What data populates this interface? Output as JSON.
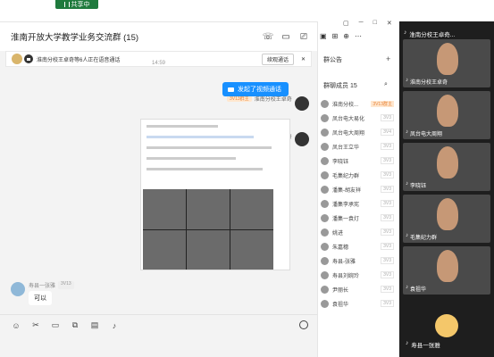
{
  "share_bar": {
    "label": "共享中"
  },
  "chat": {
    "title": "淮南开放大学教学业务交流群 (15)",
    "banner": {
      "text": "淮南分校王卓奇等6人正在语音通话",
      "button": "续观通话"
    },
    "time": "14:59",
    "sender": {
      "tag": "3V13群主",
      "name": "淮南分校王卓奇"
    },
    "call_bubble": "发起了视频通话",
    "incoming": {
      "name": "寿县一张雅",
      "tag": "3V13",
      "text": "可以"
    }
  },
  "side": {
    "notice_label": "群公告",
    "members_label": "群聊成员 15",
    "members": [
      {
        "name": "淮南分校...",
        "tag": "3V13群主",
        "hl": true
      },
      {
        "name": "凤台电大易化",
        "tag": "3V3",
        "hl": false
      },
      {
        "name": "凤台电大周翔",
        "tag": "3V4",
        "hl": false
      },
      {
        "name": "凤台王立华",
        "tag": "3V3",
        "hl": false
      },
      {
        "name": "李晓钰",
        "tag": "3V3",
        "hl": false
      },
      {
        "name": "毛集纪力群",
        "tag": "3V3",
        "hl": false
      },
      {
        "name": "潘集-胡友祥",
        "tag": "3V3",
        "hl": false
      },
      {
        "name": "潘集李承宪",
        "tag": "3V3",
        "hl": false
      },
      {
        "name": "潘集一袁灯",
        "tag": "3V3",
        "hl": false
      },
      {
        "name": "姚进",
        "tag": "3V3",
        "hl": false
      },
      {
        "name": "朱嘉穗",
        "tag": "3V3",
        "hl": false
      },
      {
        "name": "寿县-张雅",
        "tag": "3V3",
        "hl": false
      },
      {
        "name": "寿县刘婉玲",
        "tag": "3V3",
        "hl": false
      },
      {
        "name": "尹丽长",
        "tag": "3V3",
        "hl": false
      },
      {
        "name": "袁祖华",
        "tag": "3V3",
        "hl": false
      }
    ]
  },
  "video": {
    "top_label": "淮南分校王卓奇...",
    "tiles": [
      "淮南分校王卓奇",
      "凤台电大周翔",
      "李晓钰",
      "毛集纪力群",
      "袁祖华"
    ],
    "bottom_label": "寿县一张雅"
  },
  "colors": {
    "accent": "#1890ff",
    "owner_tag": "#e8853a"
  }
}
